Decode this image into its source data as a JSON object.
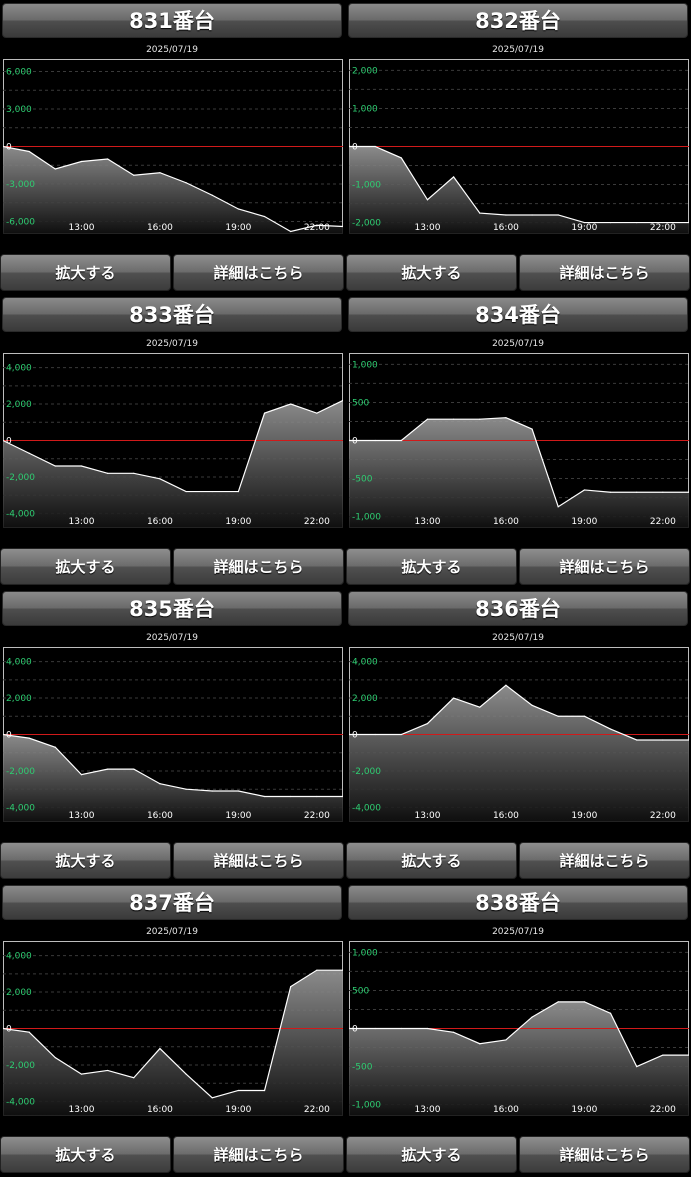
{
  "date_label": "2025/07/19",
  "buttons": {
    "zoom": "拡大する",
    "details": "詳細はこちら"
  },
  "colors": {
    "axis_label": "#2ecc71",
    "zero_line": "#d11a1a",
    "series_line": "#ffffff",
    "grid": "#3a3a3a",
    "background": "#000000"
  },
  "machines": [
    {
      "title": "831番台",
      "chart_data": {
        "type": "area",
        "x": [
          "10:00",
          "11:00",
          "12:00",
          "13:00",
          "14:00",
          "15:00",
          "16:00",
          "17:00",
          "18:00",
          "19:00",
          "20:00",
          "21:00",
          "22:00",
          "22:59"
        ],
        "x_ticks": [
          "13:00",
          "16:00",
          "19:00",
          "22:00"
        ],
        "y_ticks": [
          6000,
          3000,
          0,
          -3000,
          -6000
        ],
        "y_tick_labels": [
          "6,000",
          "3,000",
          "0",
          "-3,000",
          "-6,000"
        ],
        "ylim": [
          -7000,
          7000
        ],
        "values": [
          0,
          -400,
          -1800,
          -1200,
          -1000,
          -2300,
          -2100,
          -2900,
          -3900,
          -5000,
          -5600,
          -6800,
          -6300,
          -6400
        ]
      }
    },
    {
      "title": "832番台",
      "chart_data": {
        "type": "area",
        "x": [
          "10:00",
          "11:00",
          "12:00",
          "13:00",
          "14:00",
          "15:00",
          "16:00",
          "17:00",
          "18:00",
          "19:00",
          "20:00",
          "21:00",
          "22:00",
          "22:59"
        ],
        "x_ticks": [
          "13:00",
          "16:00",
          "19:00",
          "22:00"
        ],
        "y_ticks": [
          2000,
          1000,
          0,
          -1000,
          -2000
        ],
        "y_tick_labels": [
          "2,000",
          "1,000",
          "0",
          "-1,000",
          "-2,000"
        ],
        "ylim": [
          -2300,
          2300
        ],
        "values": [
          0,
          0,
          -300,
          -1400,
          -800,
          -1750,
          -1800,
          -1800,
          -1800,
          -2000,
          -2000,
          -2000,
          -2000,
          -2000
        ]
      }
    },
    {
      "title": "833番台",
      "chart_data": {
        "type": "area",
        "x": [
          "10:00",
          "11:00",
          "12:00",
          "13:00",
          "14:00",
          "15:00",
          "16:00",
          "17:00",
          "18:00",
          "19:00",
          "20:00",
          "21:00",
          "22:00",
          "22:59"
        ],
        "x_ticks": [
          "13:00",
          "16:00",
          "19:00",
          "22:00"
        ],
        "y_ticks": [
          4000,
          2000,
          0,
          -2000,
          -4000
        ],
        "y_tick_labels": [
          "4,000",
          "2,000",
          "0",
          "-2,000",
          "-4,000"
        ],
        "ylim": [
          -4800,
          4800
        ],
        "values": [
          0,
          -700,
          -1400,
          -1400,
          -1800,
          -1800,
          -2100,
          -2800,
          -2800,
          -2800,
          1500,
          2000,
          1500,
          2200
        ]
      }
    },
    {
      "title": "834番台",
      "chart_data": {
        "type": "area",
        "x": [
          "10:00",
          "11:00",
          "12:00",
          "13:00",
          "14:00",
          "15:00",
          "16:00",
          "17:00",
          "18:00",
          "19:00",
          "20:00",
          "21:00",
          "22:00",
          "22:59"
        ],
        "x_ticks": [
          "13:00",
          "16:00",
          "19:00",
          "22:00"
        ],
        "y_ticks": [
          1000,
          500,
          0,
          -500,
          -1000
        ],
        "y_tick_labels": [
          "1,000",
          "500",
          "0",
          "-500",
          "-1,000"
        ],
        "ylim": [
          -1150,
          1150
        ],
        "values": [
          0,
          0,
          0,
          280,
          280,
          280,
          300,
          150,
          -870,
          -650,
          -680,
          -680,
          -680,
          -680
        ]
      }
    },
    {
      "title": "835番台",
      "chart_data": {
        "type": "area",
        "x": [
          "10:00",
          "11:00",
          "12:00",
          "13:00",
          "14:00",
          "15:00",
          "16:00",
          "17:00",
          "18:00",
          "19:00",
          "20:00",
          "21:00",
          "22:00",
          "22:59"
        ],
        "x_ticks": [
          "13:00",
          "16:00",
          "19:00",
          "22:00"
        ],
        "y_ticks": [
          4000,
          2000,
          0,
          -2000,
          -4000
        ],
        "y_tick_labels": [
          "4,000",
          "2,000",
          "0",
          "-2,000",
          "-4,000"
        ],
        "ylim": [
          -4800,
          4800
        ],
        "values": [
          0,
          -200,
          -700,
          -2200,
          -1900,
          -1900,
          -2700,
          -3000,
          -3100,
          -3100,
          -3400,
          -3400,
          -3400,
          -3400
        ]
      }
    },
    {
      "title": "836番台",
      "chart_data": {
        "type": "area",
        "x": [
          "10:00",
          "11:00",
          "12:00",
          "13:00",
          "14:00",
          "15:00",
          "16:00",
          "17:00",
          "18:00",
          "19:00",
          "20:00",
          "21:00",
          "22:00",
          "22:59"
        ],
        "x_ticks": [
          "13:00",
          "16:00",
          "19:00",
          "22:00"
        ],
        "y_ticks": [
          4000,
          2000,
          0,
          -2000,
          -4000
        ],
        "y_tick_labels": [
          "4,000",
          "2,000",
          "0",
          "-2,000",
          "-4,000"
        ],
        "ylim": [
          -4800,
          4800
        ],
        "values": [
          0,
          0,
          0,
          600,
          2000,
          1500,
          2700,
          1600,
          1000,
          1000,
          300,
          -300,
          -300,
          -300
        ]
      }
    },
    {
      "title": "837番台",
      "chart_data": {
        "type": "area",
        "x": [
          "10:00",
          "11:00",
          "12:00",
          "13:00",
          "14:00",
          "15:00",
          "16:00",
          "17:00",
          "18:00",
          "19:00",
          "20:00",
          "21:00",
          "22:00",
          "22:59"
        ],
        "x_ticks": [
          "13:00",
          "16:00",
          "19:00",
          "22:00"
        ],
        "y_ticks": [
          4000,
          2000,
          0,
          -2000,
          -4000
        ],
        "y_tick_labels": [
          "4,000",
          "2,000",
          "0",
          "-2,000",
          "-4,000"
        ],
        "ylim": [
          -4800,
          4800
        ],
        "values": [
          0,
          -200,
          -1600,
          -2500,
          -2300,
          -2700,
          -1100,
          -2500,
          -3800,
          -3400,
          -3400,
          2300,
          3200,
          3200
        ]
      }
    },
    {
      "title": "838番台",
      "chart_data": {
        "type": "area",
        "x": [
          "10:00",
          "11:00",
          "12:00",
          "13:00",
          "14:00",
          "15:00",
          "16:00",
          "17:00",
          "18:00",
          "19:00",
          "20:00",
          "21:00",
          "22:00",
          "22:59"
        ],
        "x_ticks": [
          "13:00",
          "16:00",
          "19:00",
          "22:00"
        ],
        "y_ticks": [
          1000,
          500,
          0,
          -500,
          -1000
        ],
        "y_tick_labels": [
          "1,000",
          "500",
          "0",
          "-500",
          "-1,000"
        ],
        "ylim": [
          -1150,
          1150
        ],
        "values": [
          0,
          0,
          0,
          0,
          -50,
          -200,
          -150,
          150,
          350,
          350,
          200,
          -500,
          -350,
          -350
        ]
      }
    }
  ]
}
